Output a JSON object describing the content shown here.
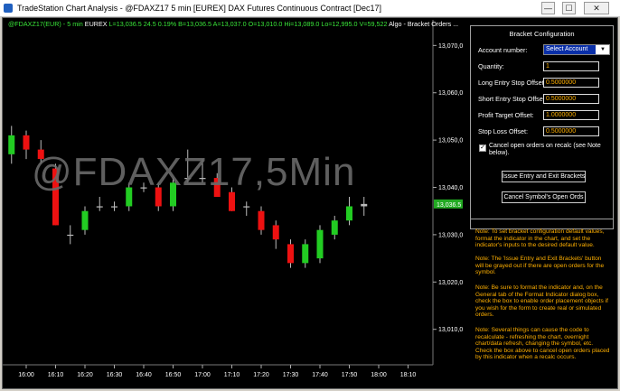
{
  "window": {
    "title": "TradeStation Chart Analysis - @FDAXZ17 5 min [EUREX] DAX  Futures Continuous Contract [Dec17]",
    "buttons": {
      "minimize": "—",
      "maximize": "☐",
      "close": "✕"
    }
  },
  "chart": {
    "symbol": "@FDAXZ17(EUR) - 5 min",
    "exchange": "EUREX",
    "stats": "L=13,036.5  24.5  0.19%  B=13,036.5  A=13,037.0  O=13,010.0  Hi=13,089.0  Lo=12,995.0  V=59,522",
    "study": "Algo - Bracket Orders ...",
    "watermark": "@FDAXZ17,5Min",
    "price_tag": "13,036.5",
    "colors": {
      "up": "#22cc22",
      "down": "#ee1111",
      "grid": "#1a1a1a",
      "axis_text": "#ffffff",
      "price_tag_bg": "#22aa22"
    }
  },
  "chart_data": {
    "type": "candlestick",
    "x_ticks": [
      "16:00",
      "16:10",
      "16:20",
      "16:30",
      "16:40",
      "16:50",
      "17:00",
      "17:10",
      "17:20",
      "17:30",
      "17:40",
      "17:50",
      "18:00",
      "18:10"
    ],
    "y_ticks": [
      13070,
      13060,
      13050,
      13040,
      13030,
      13020,
      13010
    ],
    "y_tick_labels": [
      "13,070,0",
      "13,060,0",
      "13,050,0",
      "13,040,0",
      "13,030,0",
      "13,020,0",
      "13,010,0"
    ],
    "ylim": [
      13002.5,
      13073.5
    ],
    "bars": [
      {
        "t": "15:55",
        "o": 13047,
        "h": 13053,
        "l": 13045,
        "c": 13051
      },
      {
        "t": "16:00",
        "o": 13051,
        "h": 13052,
        "l": 13046,
        "c": 13048
      },
      {
        "t": "16:05",
        "o": 13048,
        "h": 13050,
        "l": 13045,
        "c": 13046
      },
      {
        "t": "16:10",
        "o": 13044,
        "h": 13045,
        "l": 13032,
        "c": 13032
      },
      {
        "t": "16:15",
        "o": 13030,
        "h": 13032,
        "l": 13028,
        "c": 13030
      },
      {
        "t": "16:20",
        "o": 13031,
        "h": 13036,
        "l": 13030,
        "c": 13035
      },
      {
        "t": "16:25",
        "o": 13036,
        "h": 13038,
        "l": 13035,
        "c": 13036
      },
      {
        "t": "16:30",
        "o": 13036,
        "h": 13037,
        "l": 13035,
        "c": 13036
      },
      {
        "t": "16:35",
        "o": 13036,
        "h": 13041,
        "l": 13035,
        "c": 13040
      },
      {
        "t": "16:40",
        "o": 13040,
        "h": 13041,
        "l": 13039,
        "c": 13040
      },
      {
        "t": "16:45",
        "o": 13040,
        "h": 13041,
        "l": 13035,
        "c": 13036
      },
      {
        "t": "16:50",
        "o": 13036,
        "h": 13042,
        "l": 13035,
        "c": 13041
      },
      {
        "t": "16:55",
        "o": 13042,
        "h": 13048,
        "l": 13041,
        "c": 13042
      },
      {
        "t": "17:00",
        "o": 13042,
        "h": 13046,
        "l": 13041,
        "c": 13042
      },
      {
        "t": "17:05",
        "o": 13042,
        "h": 13043,
        "l": 13038,
        "c": 13038
      },
      {
        "t": "17:10",
        "o": 13039,
        "h": 13040,
        "l": 13035,
        "c": 13035
      },
      {
        "t": "17:15",
        "o": 13036,
        "h": 13037,
        "l": 13034,
        "c": 13036
      },
      {
        "t": "17:20",
        "o": 13035,
        "h": 13036,
        "l": 13030,
        "c": 13031
      },
      {
        "t": "17:25",
        "o": 13032,
        "h": 13033,
        "l": 13027,
        "c": 13029
      },
      {
        "t": "17:30",
        "o": 13028,
        "h": 13029,
        "l": 13023,
        "c": 13024
      },
      {
        "t": "17:35",
        "o": 13024,
        "h": 13029,
        "l": 13023,
        "c": 13028
      },
      {
        "t": "17:40",
        "o": 13025,
        "h": 13032,
        "l": 13024,
        "c": 13031
      },
      {
        "t": "17:45",
        "o": 13030,
        "h": 13034,
        "l": 13029,
        "c": 13033
      },
      {
        "t": "17:50",
        "o": 13033,
        "h": 13038,
        "l": 13032,
        "c": 13036
      },
      {
        "t": "17:55",
        "o": 13036,
        "h": 13038,
        "l": 13034,
        "c": 13036.5
      }
    ]
  },
  "panel": {
    "title": "Bracket Configuration",
    "fields": [
      {
        "label": "Account number:",
        "value": "Select Account"
      },
      {
        "label": "Quantity:",
        "value": "1"
      },
      {
        "label": "Long Entry Stop Offset:",
        "value": "0.5000000"
      },
      {
        "label": "Short Entry Stop Offset:",
        "value": "0.5000000"
      },
      {
        "label": "Profit Target Offset:",
        "value": "1.0000000"
      },
      {
        "label": "Stop Loss Offset:",
        "value": "0.5000000"
      }
    ],
    "checkbox": {
      "checked": true,
      "mark": "✓",
      "label": "Cancel open orders on recalc (see Note below)."
    },
    "buttons": {
      "issue": "Issue Entry and Exit Brackets",
      "cancel": "Cancel Symbol's Open Ords"
    },
    "notes": [
      "Note:  To set bracket configuration default values, format the indicator in the chart, and set the indicator's inputs to the desired default value.",
      "Note:  The 'Issue Entry and Exit Brackets' button will be grayed out if there are open orders for the symbol.",
      "Note:  Be sure to format the indicator and, on the General tab of the Format Indicator dialog box, check the box to enable order placement objects if you wish for the form to create real or simulated orders.",
      "Note:  Several things can cause the code to recalculate - refreshing the chart, overnight chart/data refresh,  changing the symbol, etc. Check the box above to cancel open orders placed by this indicator when a recalc occurs."
    ]
  }
}
